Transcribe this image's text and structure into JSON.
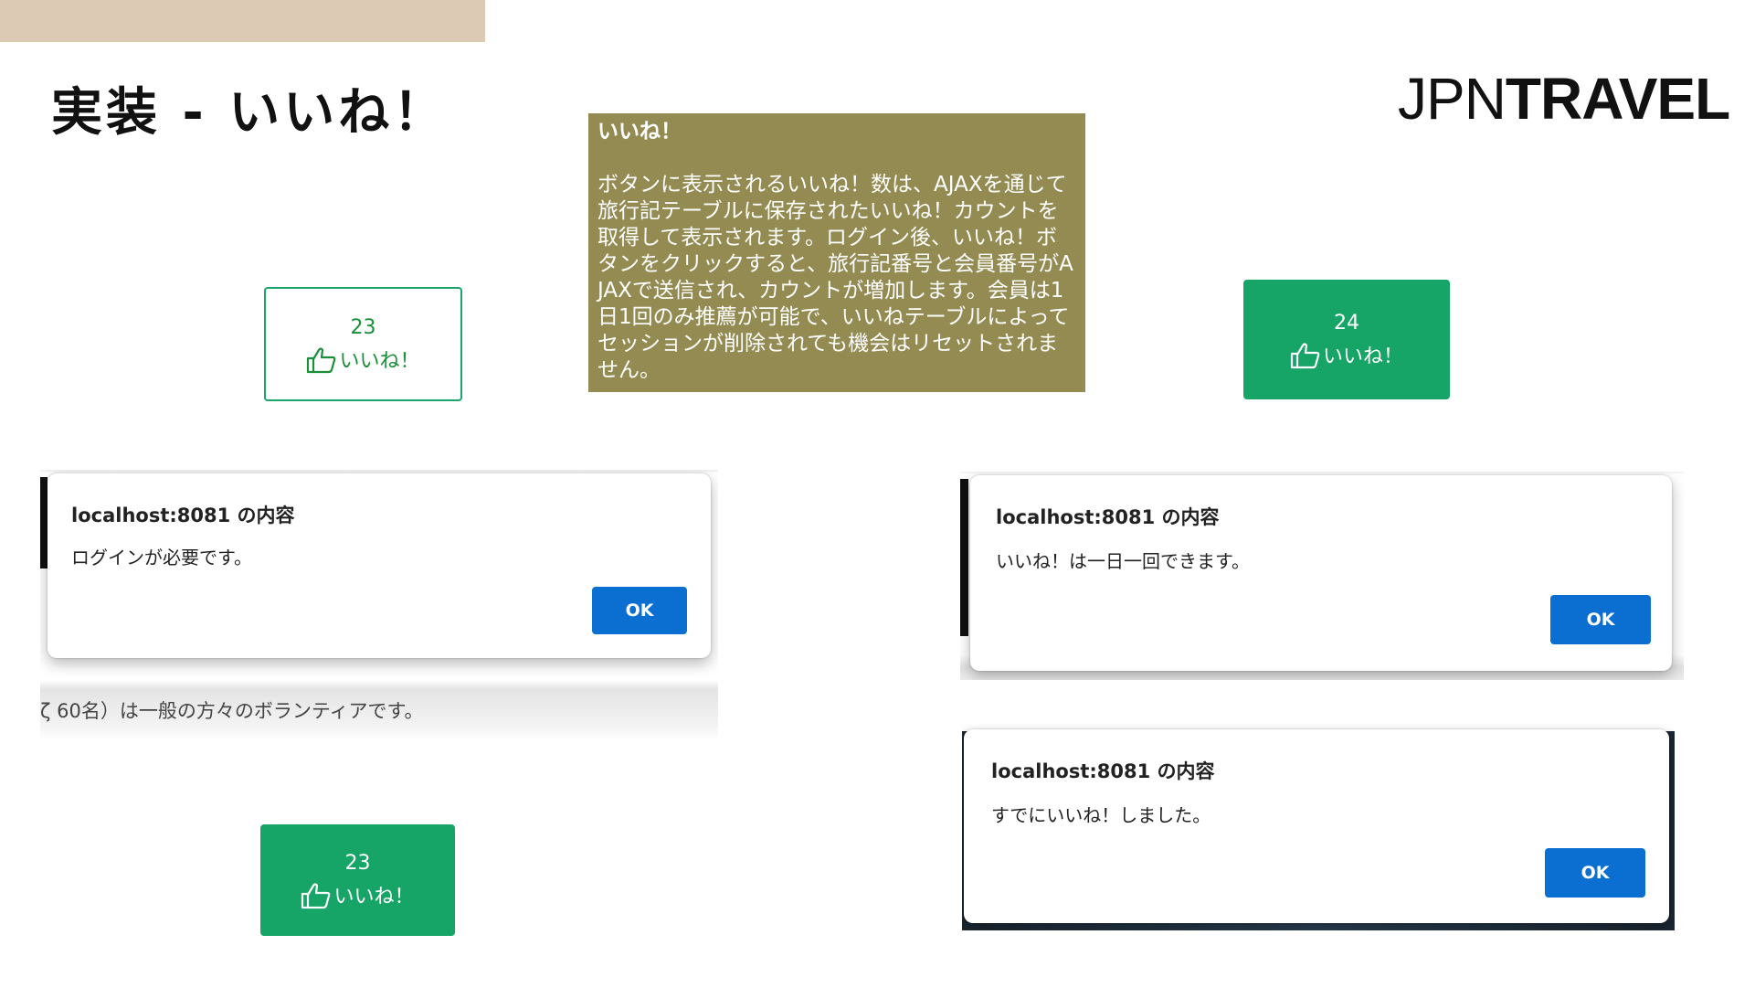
{
  "slide": {
    "title": "実装 - いいね！",
    "logo_thin": "JPN",
    "logo_bold": "TRAVEL"
  },
  "description": {
    "title": "いいね！",
    "body": "ボタンに表示されるいいね！数は、AJAXを通じて旅行記テーブルに保存されたいいね！カウントを取得して表示されます。ログイン後、いいね！ボタンをクリックすると、旅行記番号と会員番号がAJAXで送信され、カウントが増加します。会員は1日1回のみ推薦が可能で、いいねテーブルによってセッションが削除されても機会はリセットされません。"
  },
  "like_buttons": [
    {
      "count": "23",
      "label": "いいね！",
      "style": "outline"
    },
    {
      "count": "24",
      "label": "いいね！",
      "style": "solid"
    },
    {
      "count": "23",
      "label": "いいね！",
      "style": "solid"
    }
  ],
  "dialogs": [
    {
      "title": "localhost:8081 の内容",
      "message": "ログインが必要です。",
      "ok_label": "OK"
    },
    {
      "title": "localhost:8081 の内容",
      "message": "いいね！は一日一回できます。",
      "ok_label": "OK"
    },
    {
      "title": "localhost:8081 の内容",
      "message": "すでにいいね！しました。",
      "ok_label": "OK"
    }
  ],
  "background_text": "ζ 60名）は一般の方々のボランティアです。",
  "icons": {
    "like": "thumbs-up-icon"
  },
  "colors": {
    "accent_green": "#16a566",
    "ok_blue": "#0b6fd1",
    "desc_box": "#938b52",
    "top_strip": "#ddcab5"
  }
}
